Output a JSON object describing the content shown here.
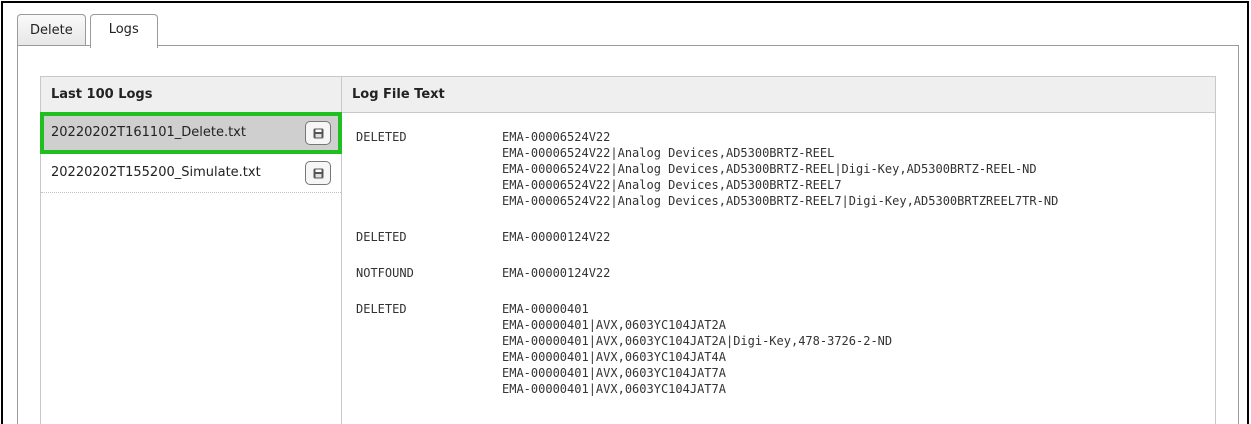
{
  "tabs": [
    {
      "label": "Delete",
      "active": false
    },
    {
      "label": "Logs",
      "active": true
    }
  ],
  "grid": {
    "col_logs_header": "Last 100 Logs",
    "col_text_header": "Log File Text"
  },
  "files": [
    {
      "name": "20220202T161101_Delete.txt",
      "selected": true
    },
    {
      "name": "20220202T155200_Simulate.txt",
      "selected": false
    }
  ],
  "log_entries": [
    {
      "status": "DELETED",
      "lines": [
        "EMA-00006524V22",
        "EMA-00006524V22|Analog Devices,AD5300BRTZ-REEL",
        "EMA-00006524V22|Analog Devices,AD5300BRTZ-REEL|Digi-Key,AD5300BRTZ-REEL-ND",
        "EMA-00006524V22|Analog Devices,AD5300BRTZ-REEL7",
        "EMA-00006524V22|Analog Devices,AD5300BRTZ-REEL7|Digi-Key,AD5300BRTZREEL7TR-ND"
      ]
    },
    {
      "status": "DELETED",
      "lines": [
        "EMA-00000124V22"
      ]
    },
    {
      "status": "NOTFOUND",
      "lines": [
        "EMA-00000124V22"
      ]
    },
    {
      "status": "DELETED",
      "lines": [
        "EMA-00000401",
        "EMA-00000401|AVX,0603YC104JAT2A",
        "EMA-00000401|AVX,0603YC104JAT2A|Digi-Key,478-3726-2-ND",
        "EMA-00000401|AVX,0603YC104JAT4A",
        "EMA-00000401|AVX,0603YC104JAT7A",
        "EMA-00000401|AVX,0603YC104JAT7A"
      ]
    }
  ],
  "colors": {
    "selected_outline": "#1fbf1f",
    "selected_bg": "#cfcfcf",
    "header_bg": "#efefef"
  }
}
